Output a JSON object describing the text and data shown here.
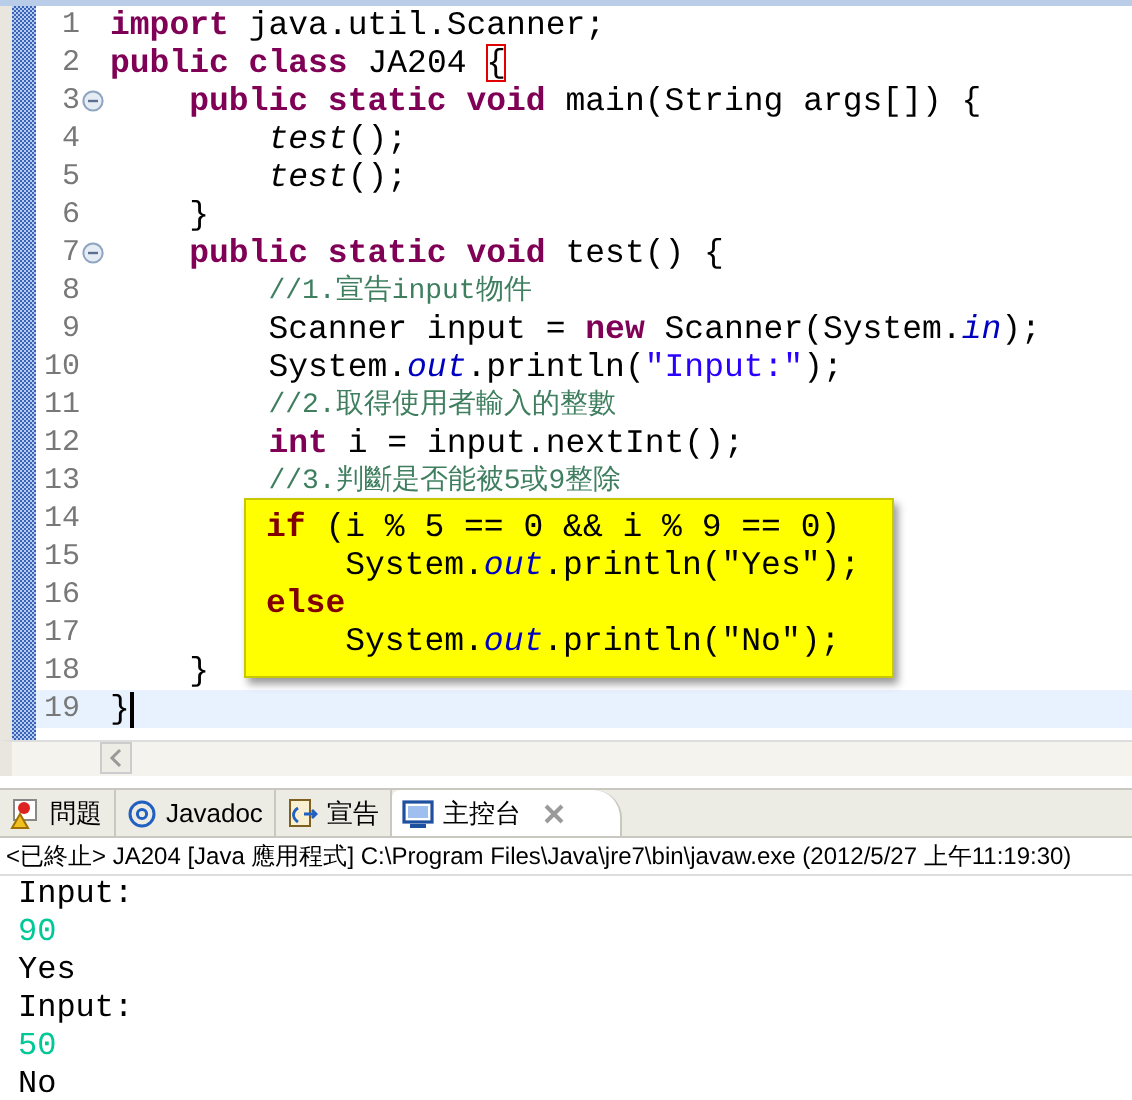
{
  "editor": {
    "lines": [
      {
        "number": "1",
        "current": false,
        "tokens": [
          {
            "kind": "keyword",
            "text": "import"
          },
          {
            "kind": "plain",
            "text": " java.util.Scanner;"
          }
        ]
      },
      {
        "number": "2",
        "current": false,
        "tokens": [
          {
            "kind": "keyword",
            "text": "public class"
          },
          {
            "kind": "plain",
            "text": " JA204 "
          },
          {
            "kind": "bracket",
            "text": "{"
          }
        ]
      },
      {
        "number": "3",
        "current": false,
        "fold": {
          "expanded": true
        },
        "tokens": [
          {
            "kind": "keyword",
            "text": "    public static void"
          },
          {
            "kind": "plain",
            "text": " main(String args[]) {"
          }
        ]
      },
      {
        "number": "4",
        "current": false,
        "tokens": [
          {
            "kind": "method",
            "text": "        test"
          },
          {
            "kind": "plain",
            "text": "();"
          }
        ]
      },
      {
        "number": "5",
        "current": false,
        "tokens": [
          {
            "kind": "method",
            "text": "        test"
          },
          {
            "kind": "plain",
            "text": "();"
          }
        ]
      },
      {
        "number": "6",
        "current": false,
        "tokens": [
          {
            "kind": "plain",
            "text": "    }"
          }
        ]
      },
      {
        "number": "7",
        "current": false,
        "fold": {
          "expanded": true
        },
        "tokens": [
          {
            "kind": "keyword",
            "text": "    public static void"
          },
          {
            "kind": "plain",
            "text": " test() {"
          }
        ]
      },
      {
        "number": "8",
        "current": false,
        "tokens": [
          {
            "kind": "comment",
            "text": "        //1.宣告input物件"
          }
        ]
      },
      {
        "number": "9",
        "current": false,
        "tokens": [
          {
            "kind": "plain",
            "text": "        Scanner input = "
          },
          {
            "kind": "keyword",
            "text": "new"
          },
          {
            "kind": "plain",
            "text": " Scanner(System."
          },
          {
            "kind": "field",
            "text": "in"
          },
          {
            "kind": "plain",
            "text": ");"
          }
        ]
      },
      {
        "number": "10",
        "current": false,
        "tokens": [
          {
            "kind": "plain",
            "text": "        System."
          },
          {
            "kind": "field",
            "text": "out"
          },
          {
            "kind": "plain",
            "text": ".println("
          },
          {
            "kind": "string",
            "text": "\"Input:\""
          },
          {
            "kind": "plain",
            "text": ");"
          }
        ]
      },
      {
        "number": "11",
        "current": false,
        "tokens": [
          {
            "kind": "comment",
            "text": "        //2.取得使用者輸入的整數"
          }
        ]
      },
      {
        "number": "12",
        "current": false,
        "tokens": [
          {
            "kind": "keyword",
            "text": "        int"
          },
          {
            "kind": "plain",
            "text": " i = input.nextInt();"
          }
        ]
      },
      {
        "number": "13",
        "current": false,
        "tokens": [
          {
            "kind": "comment",
            "text": "        //3.判斷是否能被5或9整除"
          }
        ]
      },
      {
        "number": "14",
        "current": false
      },
      {
        "number": "15",
        "current": false
      },
      {
        "number": "16",
        "current": false
      },
      {
        "number": "17",
        "current": false
      },
      {
        "number": "18",
        "current": false,
        "tokens": [
          {
            "kind": "plain",
            "text": "    }"
          }
        ]
      },
      {
        "number": "19",
        "current": true,
        "tokens": [
          {
            "kind": "plain",
            "text": "}"
          }
        ]
      }
    ],
    "hover_popup": {
      "lines": [
        {
          "tokens": [
            {
              "kind": "keyword",
              "text": "if"
            },
            {
              "kind": "plain",
              "text": " (i % 5 == 0 && i % 9 == 0)"
            }
          ]
        },
        {
          "tokens": [
            {
              "kind": "plain",
              "text": "    System."
            },
            {
              "kind": "field",
              "text": "out"
            },
            {
              "kind": "plain",
              "text": ".println(\"Yes\");"
            }
          ]
        },
        {
          "tokens": [
            {
              "kind": "keyword",
              "text": "else"
            }
          ]
        },
        {
          "tokens": [
            {
              "kind": "plain",
              "text": "    System."
            },
            {
              "kind": "field",
              "text": "out"
            },
            {
              "kind": "plain",
              "text": ".println(\"No\");"
            }
          ]
        }
      ]
    }
  },
  "panel_tabs": [
    {
      "label": "問題",
      "selected": false,
      "closable": false
    },
    {
      "label": "Javadoc",
      "selected": false,
      "closable": false
    },
    {
      "label": "宣告",
      "selected": false,
      "closable": false
    },
    {
      "label": "主控台",
      "selected": true,
      "closable": true
    }
  ],
  "console": {
    "header": "<已終止> JA204 [Java 應用程式] C:\\Program Files\\Java\\jre7\\bin\\javaw.exe (2012/5/27 上午11:19:30)",
    "lines": [
      {
        "kind": "output",
        "text": "Input:"
      },
      {
        "kind": "input",
        "text": "90"
      },
      {
        "kind": "output",
        "text": "Yes"
      },
      {
        "kind": "output",
        "text": "Input:"
      },
      {
        "kind": "input",
        "text": "50"
      },
      {
        "kind": "output",
        "text": "No"
      }
    ]
  }
}
